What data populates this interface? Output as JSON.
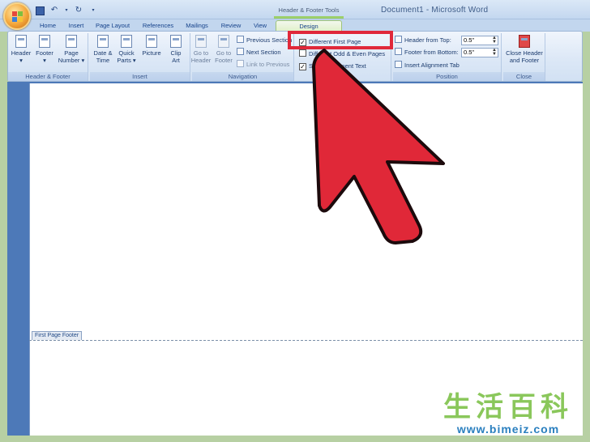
{
  "window": {
    "title": "Document1 - Microsoft Word",
    "context_tool": "Header & Footer Tools"
  },
  "tabs": [
    {
      "label": "Home"
    },
    {
      "label": "Insert"
    },
    {
      "label": "Page Layout"
    },
    {
      "label": "References"
    },
    {
      "label": "Mailings"
    },
    {
      "label": "Review"
    },
    {
      "label": "View"
    },
    {
      "label": "Design"
    }
  ],
  "ribbon": {
    "header_footer": {
      "label": "Header & Footer",
      "header": "Header",
      "footer": "Footer",
      "page_number_1": "Page",
      "page_number_2": "Number"
    },
    "insert": {
      "label": "Insert",
      "date_time_1": "Date &",
      "date_time_2": "Time",
      "quick_parts_1": "Quick",
      "quick_parts_2": "Parts",
      "picture": "Picture",
      "clip_art_1": "Clip",
      "clip_art_2": "Art"
    },
    "navigation": {
      "label": "Navigation",
      "goto_header_1": "Go to",
      "goto_header_2": "Header",
      "goto_footer_1": "Go to",
      "goto_footer_2": "Footer",
      "previous_section": "Previous Section",
      "next_section": "Next Section",
      "link_to_previous": "Link to Previous"
    },
    "options": {
      "different_first_page": "Different First Page",
      "different_odd_even": "Different Odd & Even Pages",
      "show_document_text": "Show Document Text",
      "different_first_page_checked": true,
      "different_odd_even_checked": false,
      "show_document_text_checked": true
    },
    "position": {
      "label": "Position",
      "header_from_top": "Header from Top:",
      "header_from_top_value": "0.5\"",
      "footer_from_bottom": "Footer from Bottom:",
      "footer_from_bottom_value": "0.5\"",
      "insert_alignment_tab": "Insert Alignment Tab"
    },
    "close": {
      "label": "Close",
      "close_1": "Close Header",
      "close_2": "and Footer"
    }
  },
  "document": {
    "footer_tab": "First Page Footer"
  },
  "watermark": {
    "chinese": "生活百科",
    "url": "www.bimeiz.com"
  },
  "colors": {
    "arrow": "#e02838",
    "highlight": "#e0283a",
    "ribbon_text": "#15428b"
  }
}
